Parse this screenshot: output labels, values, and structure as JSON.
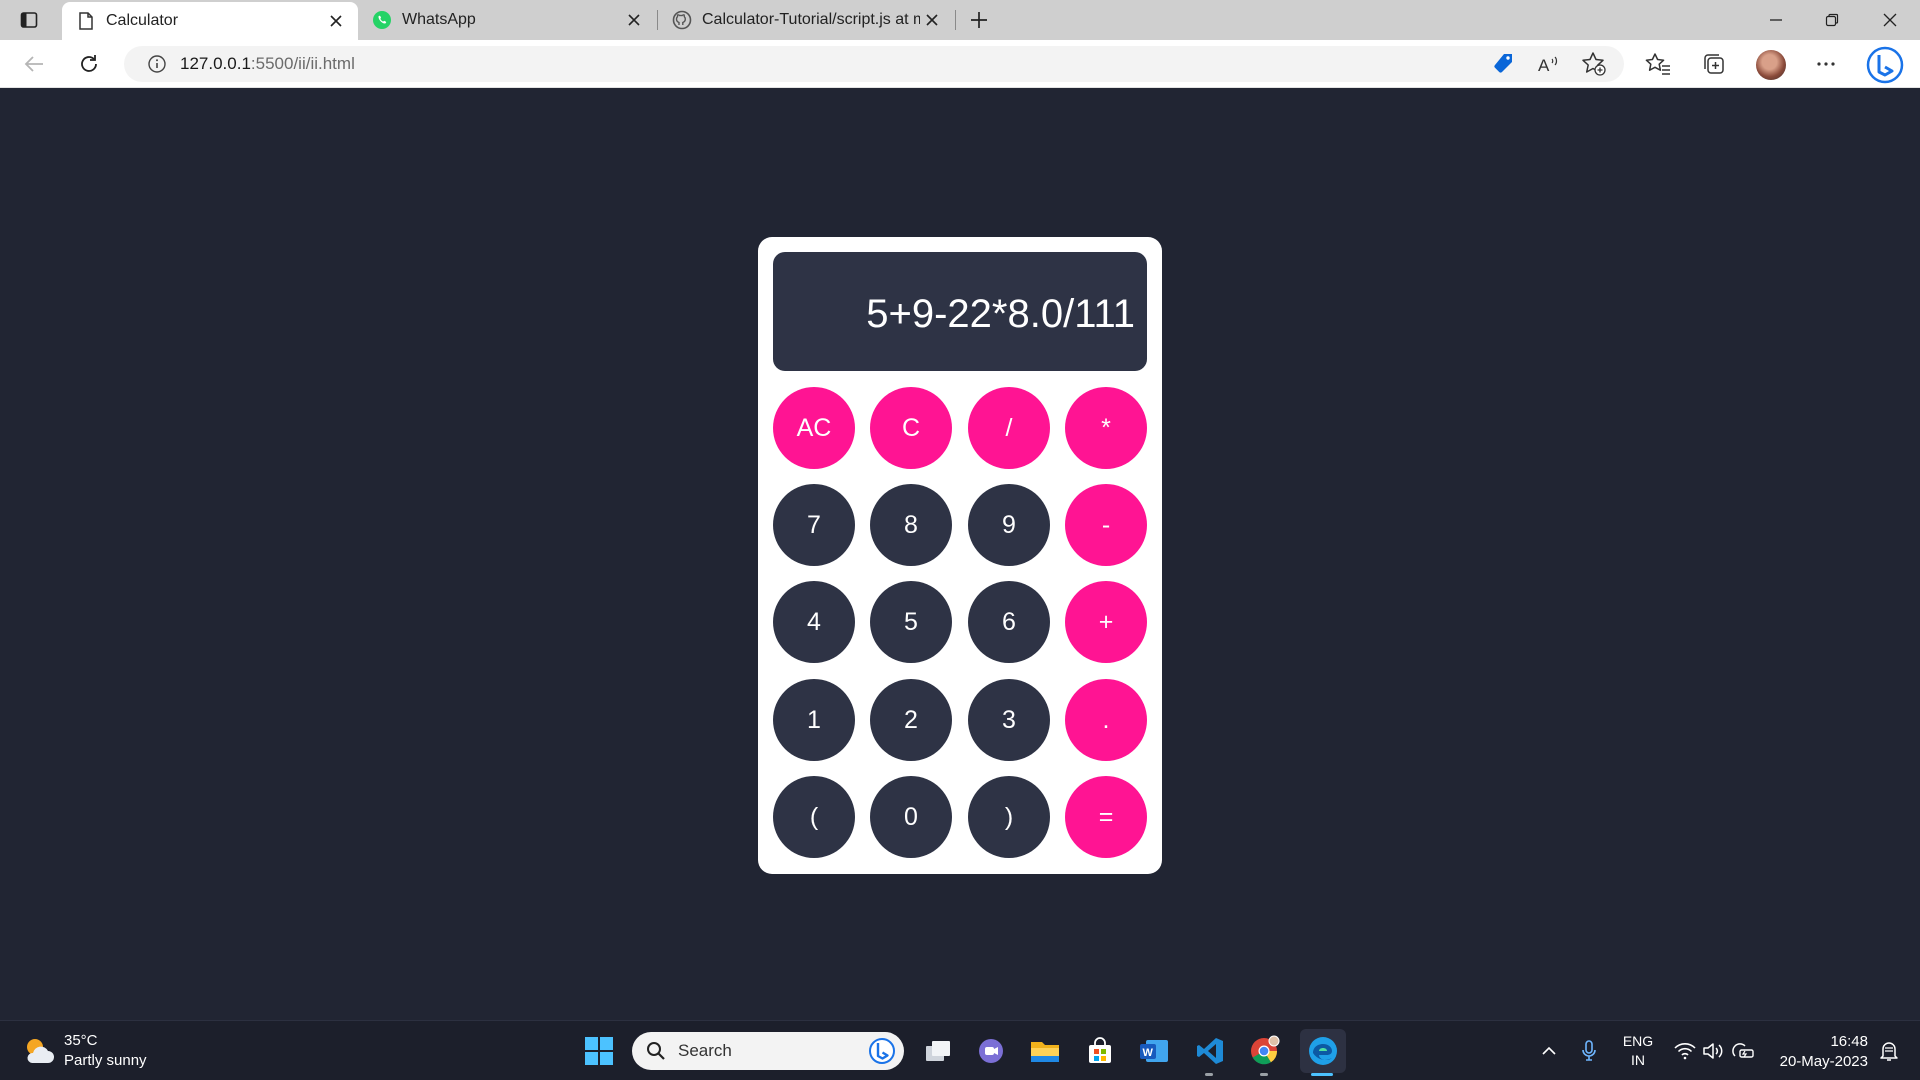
{
  "browser": {
    "tabs": [
      {
        "title": "Calculator",
        "active": true,
        "icon": "page-icon"
      },
      {
        "title": "WhatsApp",
        "active": false,
        "icon": "whatsapp-icon"
      },
      {
        "title": "Calculator-Tutorial/script.js at ma",
        "active": false,
        "icon": "github-icon"
      }
    ],
    "url_host": "127.0.0.1",
    "url_path": ":5500/ii/ii.html",
    "icons": [
      "back-icon",
      "refresh-icon",
      "info-icon",
      "shopping-tag-icon",
      "read-aloud-icon",
      "add-favorite-icon",
      "favorites-icon",
      "collections-icon",
      "profile-avatar",
      "more-icon",
      "bing-chat-icon"
    ]
  },
  "calculator": {
    "display": "5+9-22*8.0/111",
    "buttons": [
      {
        "label": "AC",
        "kind": "op"
      },
      {
        "label": "C",
        "kind": "op"
      },
      {
        "label": "/",
        "kind": "op"
      },
      {
        "label": "*",
        "kind": "op"
      },
      {
        "label": "7",
        "kind": "num"
      },
      {
        "label": "8",
        "kind": "num"
      },
      {
        "label": "9",
        "kind": "num"
      },
      {
        "label": "-",
        "kind": "op"
      },
      {
        "label": "4",
        "kind": "num"
      },
      {
        "label": "5",
        "kind": "num"
      },
      {
        "label": "6",
        "kind": "num"
      },
      {
        "label": "+",
        "kind": "op"
      },
      {
        "label": "1",
        "kind": "num"
      },
      {
        "label": "2",
        "kind": "num"
      },
      {
        "label": "3",
        "kind": "num"
      },
      {
        "label": ".",
        "kind": "op"
      },
      {
        "label": "(",
        "kind": "num"
      },
      {
        "label": "0",
        "kind": "num"
      },
      {
        "label": ")",
        "kind": "num"
      },
      {
        "label": "=",
        "kind": "op"
      }
    ],
    "colors": {
      "accent": "#ff1493",
      "key": "#2e3345",
      "page_bg": "#212533",
      "card": "#ffffff"
    }
  },
  "taskbar": {
    "weather_temp": "35°C",
    "weather_desc": "Partly sunny",
    "search_placeholder": "Search",
    "apps": [
      "task-view-icon",
      "teams-chat-icon",
      "file-explorer-icon",
      "microsoft-store-icon",
      "word-icon",
      "vscode-icon",
      "chrome-icon",
      "edge-icon"
    ],
    "lang_line1": "ENG",
    "lang_line2": "IN",
    "time": "16:48",
    "date": "20-May-2023"
  }
}
